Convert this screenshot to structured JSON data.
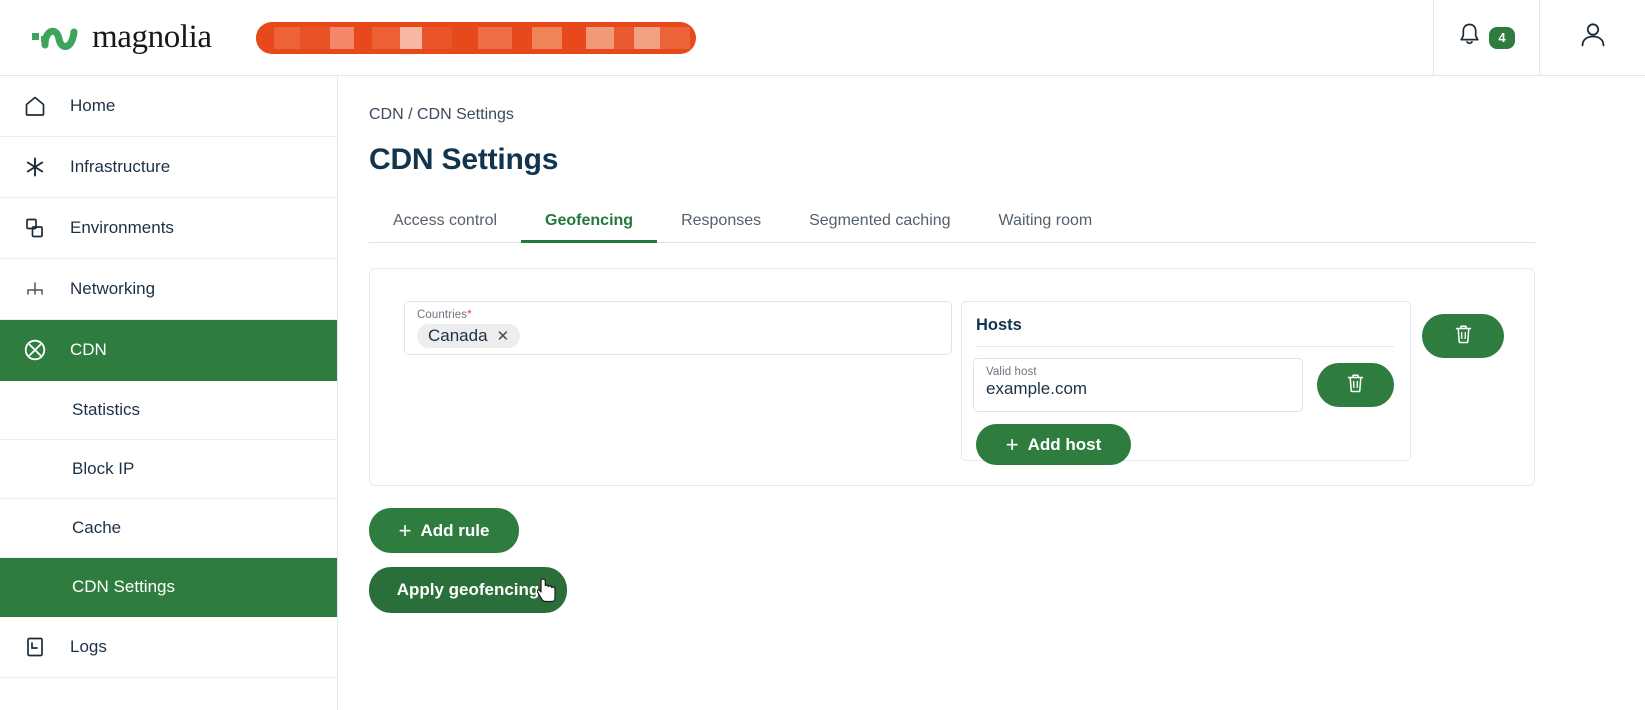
{
  "topbar": {
    "brand": "magnolia",
    "brand_icon": "magnolia-wave-logo",
    "tenant_selector": {
      "value": "",
      "redacted": true,
      "color": "#e8491c",
      "icon": "chevron-down-icon"
    },
    "notifications": {
      "icon": "bell-icon",
      "count": "4",
      "badge_color": "#2e7d3e"
    },
    "account": {
      "icon": "user-icon"
    }
  },
  "sidebar": {
    "items": [
      {
        "label": "Home",
        "icon": "home-icon",
        "active": false
      },
      {
        "label": "Infrastructure",
        "icon": "asterisk-icon",
        "active": false
      },
      {
        "label": "Environments",
        "icon": "stacked-squares-icon",
        "active": false
      },
      {
        "label": "Networking",
        "icon": "network-node-icon",
        "active": false
      },
      {
        "label": "CDN",
        "icon": "cdn-globe-x-icon",
        "active": true
      }
    ],
    "cdn_children": [
      {
        "label": "Statistics",
        "active": false
      },
      {
        "label": "Block IP",
        "active": false
      },
      {
        "label": "Cache",
        "active": false
      },
      {
        "label": "CDN Settings",
        "active": true
      }
    ],
    "items_after": [
      {
        "label": "Logs",
        "icon": "logs-icon",
        "active": false
      }
    ],
    "active_color": "#2e7d3e"
  },
  "main": {
    "breadcrumb": "CDN / CDN Settings",
    "page_title": "CDN Settings",
    "tabs": [
      {
        "label": "Access control",
        "active": false
      },
      {
        "label": "Geofencing",
        "active": true
      },
      {
        "label": "Responses",
        "active": false
      },
      {
        "label": "Segmented caching",
        "active": false
      },
      {
        "label": "Waiting room",
        "active": false
      }
    ],
    "rule": {
      "countries": {
        "label": "Countries",
        "required_marker": "*",
        "chips": [
          {
            "label": "Canada",
            "remove_icon": "close-icon"
          }
        ]
      },
      "hosts": {
        "title": "Hosts",
        "entries": [
          {
            "label": "Valid host",
            "value": "example.com",
            "delete_icon": "trash-icon"
          }
        ],
        "add_label": "Add host",
        "add_icon": "plus-icon"
      },
      "delete_icon": "trash-icon"
    },
    "actions": {
      "add_rule_label": "Add rule",
      "add_rule_icon": "plus-icon",
      "apply_label": "Apply geofencing"
    },
    "cursor": {
      "icon": "pointer-cursor",
      "visible": true
    }
  },
  "colors": {
    "brand_green": "#2e7d3e",
    "tab_active_green": "#22773c",
    "accent_orange": "#e8491c",
    "title_navy": "#12344d"
  }
}
